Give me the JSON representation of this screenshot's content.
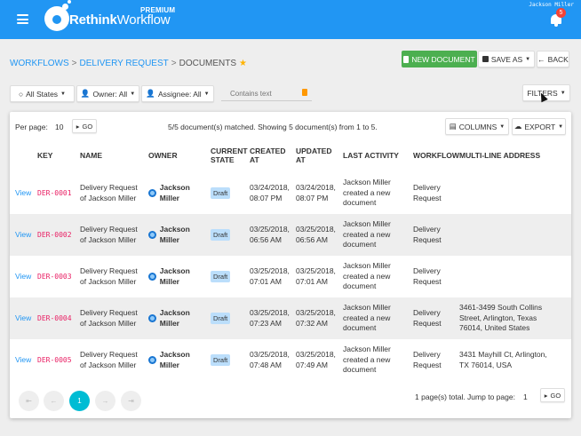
{
  "header": {
    "brand_bold": "Rethink",
    "brand_light": "Workflow",
    "premium": "PREMIUM",
    "user_name": "Jackson Miller",
    "notification_count": "5"
  },
  "breadcrumb": {
    "items": [
      "WORKFLOWS",
      "DELIVERY REQUEST",
      "DOCUMENTS"
    ],
    "separator": ">",
    "star": "★"
  },
  "actions": {
    "new_document": "NEW DOCUMENT",
    "save_as": "SAVE AS",
    "back": "BACK"
  },
  "filters": {
    "all_states": "All States",
    "owner": "Owner: All",
    "assignee": "Assignee: All",
    "contains_text_placeholder": "Contains text",
    "filters_button": "FILTERS"
  },
  "toolbar": {
    "per_page_label": "Per page:",
    "per_page_value": "10",
    "go": "GO",
    "matched": "5/5 document(s) matched. Showing 5 document(s) from 1 to 5.",
    "columns": "COLUMNS",
    "export": "EXPORT"
  },
  "table": {
    "headers": {
      "key": "KEY",
      "name": "NAME",
      "owner": "OWNER",
      "state_1": "CURRENT",
      "state_2": "STATE",
      "created_1": "CREATED",
      "created_2": "AT",
      "updated_1": "UPDATED",
      "updated_2": "AT",
      "last_activity": "LAST ACTIVITY",
      "workflow": "WORKFLOW",
      "address": "MULTI-LINE ADDRESS"
    },
    "rows": [
      {
        "view": "View",
        "key": "DER-0001",
        "name_1": "Delivery Request",
        "name_2": "of Jackson Miller",
        "owner": "Jackson Miller",
        "state": "Draft",
        "created_1": "03/24/2018,",
        "created_2": "08:07 PM",
        "updated_1": "03/24/2018,",
        "updated_2": "08:07 PM",
        "activity_1": "Jackson Miller",
        "activity_2": "created a new",
        "activity_3": "document",
        "workflow_1": "Delivery",
        "workflow_2": "Request",
        "address_1": "",
        "address_2": "",
        "address_3": ""
      },
      {
        "view": "View",
        "key": "DER-0002",
        "name_1": "Delivery Request",
        "name_2": "of Jackson Miller",
        "owner": "Jackson Miller",
        "state": "Draft",
        "created_1": "03/25/2018,",
        "created_2": "06:56 AM",
        "updated_1": "03/25/2018,",
        "updated_2": "06:56 AM",
        "activity_1": "Jackson Miller",
        "activity_2": "created a new",
        "activity_3": "document",
        "workflow_1": "Delivery",
        "workflow_2": "Request",
        "address_1": "",
        "address_2": "",
        "address_3": ""
      },
      {
        "view": "View",
        "key": "DER-0003",
        "name_1": "Delivery Request",
        "name_2": "of Jackson Miller",
        "owner": "Jackson Miller",
        "state": "Draft",
        "created_1": "03/25/2018,",
        "created_2": "07:01 AM",
        "updated_1": "03/25/2018,",
        "updated_2": "07:01 AM",
        "activity_1": "Jackson Miller",
        "activity_2": "created a new",
        "activity_3": "document",
        "workflow_1": "Delivery",
        "workflow_2": "Request",
        "address_1": "",
        "address_2": "",
        "address_3": ""
      },
      {
        "view": "View",
        "key": "DER-0004",
        "name_1": "Delivery Request",
        "name_2": "of Jackson Miller",
        "owner": "Jackson Miller",
        "state": "Draft",
        "created_1": "03/25/2018,",
        "created_2": "07:23 AM",
        "updated_1": "03/25/2018,",
        "updated_2": "07:32 AM",
        "activity_1": "Jackson Miller",
        "activity_2": "created a new",
        "activity_3": "document",
        "workflow_1": "Delivery",
        "workflow_2": "Request",
        "address_1": "3461-3499 South Collins",
        "address_2": "Street, Arlington, Texas",
        "address_3": "76014, United States"
      },
      {
        "view": "View",
        "key": "DER-0005",
        "name_1": "Delivery Request",
        "name_2": "of Jackson Miller",
        "owner": "Jackson Miller",
        "state": "Draft",
        "created_1": "03/25/2018,",
        "created_2": "07:48 AM",
        "updated_1": "03/25/2018,",
        "updated_2": "07:49 AM",
        "activity_1": "Jackson Miller",
        "activity_2": "created a new",
        "activity_3": "document",
        "workflow_1": "Delivery",
        "workflow_2": "Request",
        "address_1": "3431 Mayhill Ct, Arlington,",
        "address_2": "TX 76014, USA",
        "address_3": ""
      }
    ]
  },
  "pagination": {
    "first": "⇤",
    "prev": "←",
    "current": "1",
    "next": "→",
    "last": "⇥",
    "total_text": "1 page(s) total. Jump to page:",
    "jump_value": "1",
    "go": "GO"
  },
  "colors": {
    "primary": "#2196f3",
    "success": "#4caf50",
    "accent_page": "#00bcd4",
    "key_color": "#e91e63",
    "badge": "#f44336"
  }
}
